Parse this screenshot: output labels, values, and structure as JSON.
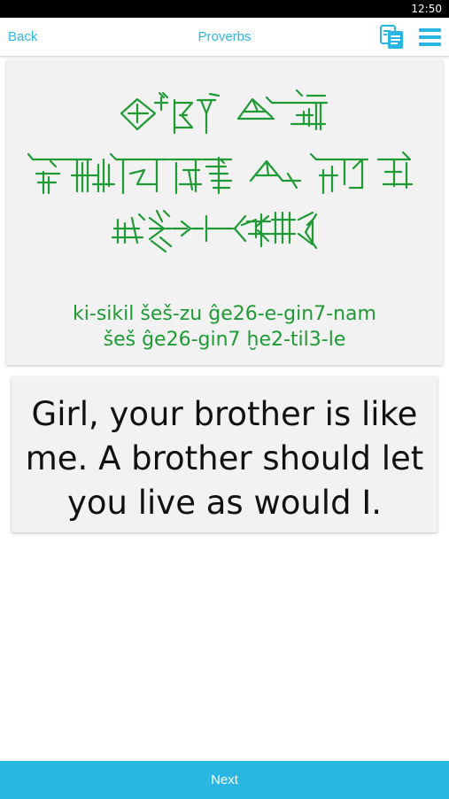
{
  "status_bar": {
    "time": "12:50"
  },
  "nav": {
    "back_label": "Back",
    "title": "Proverbs",
    "icons": [
      "copy-icon",
      "menu-icon"
    ]
  },
  "proverb": {
    "transliteration_line1": "ki-sikil šeš-zu ĝe26-e-gin7-nam",
    "transliteration_line2": "šeš ĝe26-gin7 ḫe2-til3-le",
    "translation_line1": "Girl, your brother is like",
    "translation_line2": "me. A brother should let",
    "translation_line3": "you live as would I."
  },
  "footer": {
    "next_label": "Next"
  },
  "colors": {
    "accent": "#29b6e3",
    "cuneiform": "#1f9a35",
    "card_bg": "#f2f2f2"
  }
}
